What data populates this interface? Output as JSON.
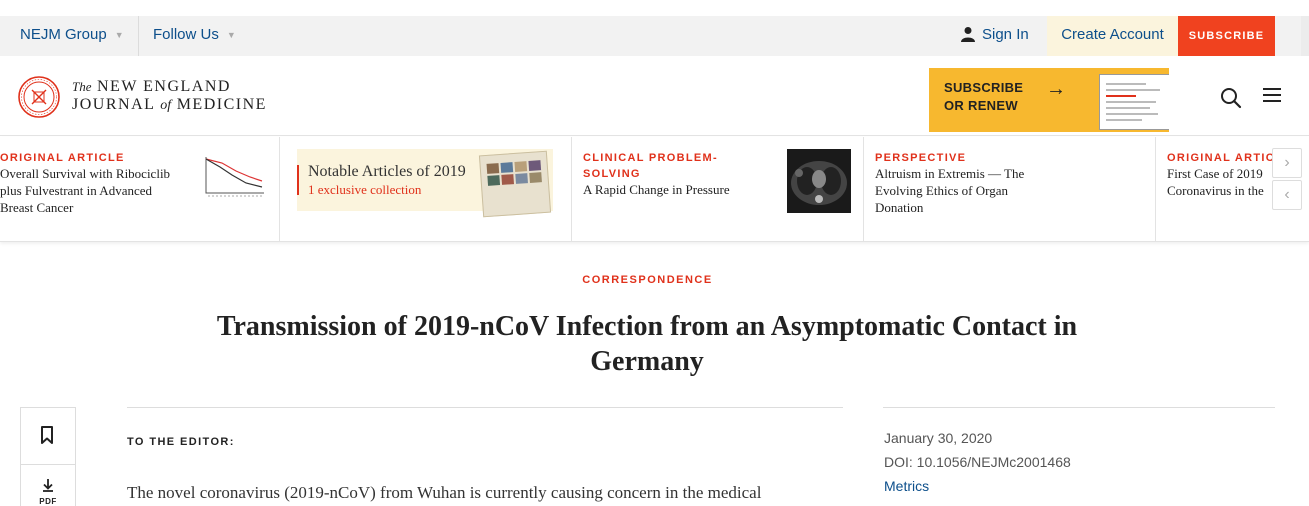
{
  "utility": {
    "group_label": "NEJM Group",
    "follow_label": "Follow Us",
    "signin_label": "Sign In",
    "create_account_label": "Create Account",
    "subscribe_label": "SUBSCRIBE"
  },
  "header": {
    "logo_the": "The",
    "logo_line1": "NEW ENGLAND",
    "logo_journal": "JOURNAL",
    "logo_of": "of",
    "logo_medicine": "MEDICINE",
    "promo_line1": "SUBSCRIBE",
    "promo_line2": "OR RENEW"
  },
  "carousel": {
    "cards": [
      {
        "category": "ORIGINAL ARTICLE",
        "title_l1": "Overall Survival with Ribociclib",
        "title_l2": "plus Fulvestrant in Advanced",
        "title_l3": "Breast Cancer"
      },
      {
        "category": "CLINICAL PROBLEM-",
        "category_l2": "SOLVING",
        "title_l1": "A Rapid Change in Pressure"
      },
      {
        "category": "PERSPECTIVE",
        "title_l1": "Altruism in Extremis — The",
        "title_l2": "Evolving Ethics of Organ",
        "title_l3": "Donation"
      },
      {
        "category": "ORIGINAL ARTICLE",
        "title_l1": "First Case of 2019",
        "title_l2": "Coronavirus in the"
      }
    ],
    "notable": {
      "title": "Notable Articles of 2019",
      "subtitle": "1 exclusive collection",
      "book_title": "Notable Articles of 2019"
    }
  },
  "article": {
    "section": "CORRESPONDENCE",
    "title_l1": "Transmission of 2019-nCoV Infection from an Asymptomatic Contact in",
    "title_l2": "Germany",
    "to_editor": "TO THE EDITOR:",
    "body_first_line": "The novel coronavirus (2019-nCoV) from Wuhan is currently causing concern in the medical",
    "date": "January 30, 2020",
    "doi": "DOI: 10.1056/NEJMc2001468",
    "metrics": "Metrics",
    "pdf_label": "PDF"
  },
  "colors": {
    "accent_red": "#e0311b",
    "subscribe_orange": "#f0421f",
    "link_blue": "#0d4f8b",
    "promo_yellow": "#f7b82f",
    "cream": "#fbf4dd"
  },
  "icons": [
    "nejm-seal-icon",
    "user-icon",
    "arrow-right-icon",
    "search-icon",
    "menu-icon",
    "bookmark-icon",
    "download-pdf-icon",
    "chevron-right-icon",
    "chevron-left-icon"
  ]
}
